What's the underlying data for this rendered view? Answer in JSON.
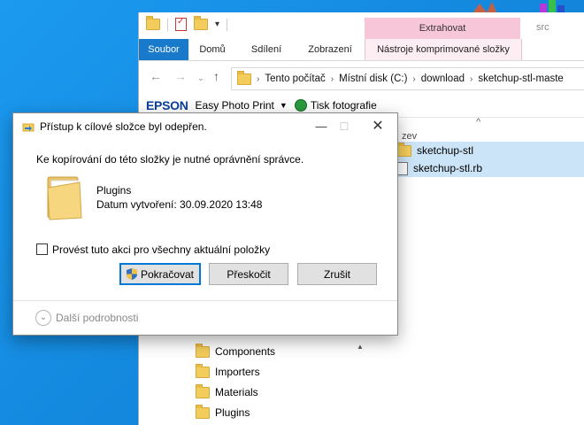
{
  "explorer": {
    "context_tab_header": "Extrahovat",
    "title_partial": "src",
    "ribbon_tabs": [
      "Soubor",
      "Domů",
      "Sdílení",
      "Zobrazení"
    ],
    "ribbon_context_tab": "Nástroje komprimované složky",
    "address_parts": [
      "Tento počítač",
      "Místní disk (C:)",
      "download",
      "sketchup-stl-maste"
    ],
    "epson": {
      "logo": "EPSON",
      "print_app": "Easy Photo Print",
      "tisk": "Tisk fotografie"
    },
    "column_header_partial": "zev",
    "files": [
      {
        "name": "sketchup-stl",
        "icon": "folder-icon"
      },
      {
        "name": "sketchup-stl.rb",
        "icon": "ruby-file-icon"
      }
    ],
    "tree": [
      "Components",
      "Importers",
      "Materials",
      "Plugins"
    ]
  },
  "dialog": {
    "title": "Přístup k cílové složce byl odepřen.",
    "message": "Ke kopírování do této složky je nutné oprávnění správce.",
    "item_name": "Plugins",
    "item_date": "Datum vytvoření: 30.09.2020 13:48",
    "checkbox_label": "Provést tuto akci pro všechny aktuální položky",
    "checkbox_checked": false,
    "buttons": {
      "continue": "Pokračovat",
      "skip": "Přeskočit",
      "cancel": "Zrušit"
    },
    "more_details": "Další podrobnosti"
  },
  "colors": {
    "desktop": "#1587de",
    "accent": "#0078d7",
    "file_tab": "#1979ca",
    "context_tab": "#f7c6d9",
    "selection": "#cce4f7"
  }
}
